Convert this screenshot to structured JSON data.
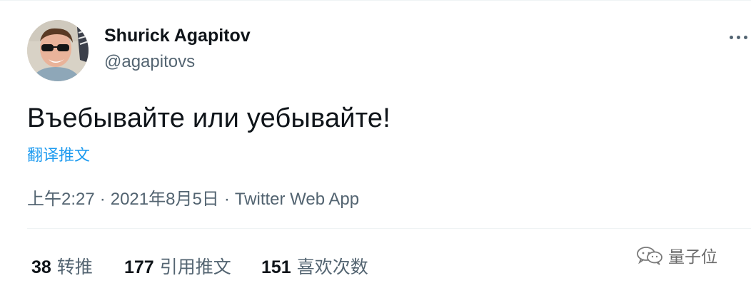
{
  "tweet": {
    "author": {
      "display_name": "Shurick Agapitov",
      "handle": "@agapitovs"
    },
    "text": "Въебывайте или уебывайте!",
    "translate_label": "翻译推文",
    "meta": {
      "time": "上午2:27",
      "separator": "·",
      "date": "2021年8月5日",
      "source": "Twitter Web App"
    },
    "stats": [
      {
        "count": "38",
        "label": "转推"
      },
      {
        "count": "177",
        "label": "引用推文"
      },
      {
        "count": "151",
        "label": "喜欢次数"
      }
    ]
  },
  "icons": {
    "more": "more-options-icon",
    "avatar": "avatar",
    "watermark_logo": "wechat-logo-icon"
  },
  "watermark": {
    "text": "量子位"
  },
  "colors": {
    "link": "#1d9bf0",
    "secondary_text": "#536471",
    "primary_text": "#0f1419",
    "divider": "#eff3f4"
  }
}
